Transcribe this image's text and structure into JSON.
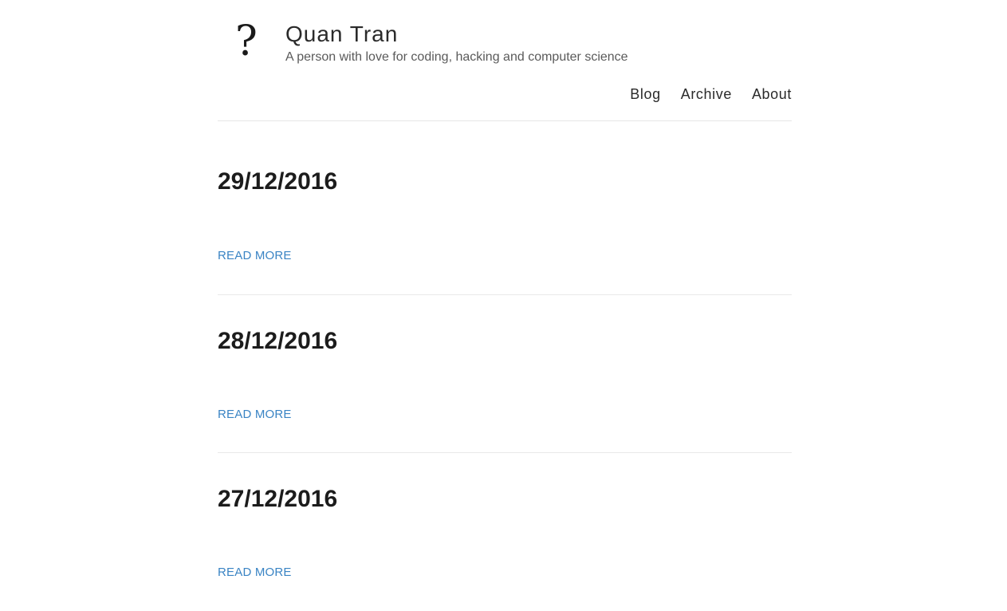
{
  "header": {
    "logo_glyph": "?",
    "title": "Quan Tran",
    "tagline": "A person with love for coding, hacking and computer science",
    "nav": [
      {
        "label": "Blog"
      },
      {
        "label": "Archive"
      },
      {
        "label": "About"
      }
    ]
  },
  "posts": [
    {
      "title": "29/12/2016",
      "read_more": "READ MORE"
    },
    {
      "title": "28/12/2016",
      "read_more": "READ MORE"
    },
    {
      "title": "27/12/2016",
      "read_more": "READ MORE"
    }
  ],
  "colors": {
    "link": "#3a84c4",
    "text": "#222222",
    "divider": "#e6e6e6"
  }
}
